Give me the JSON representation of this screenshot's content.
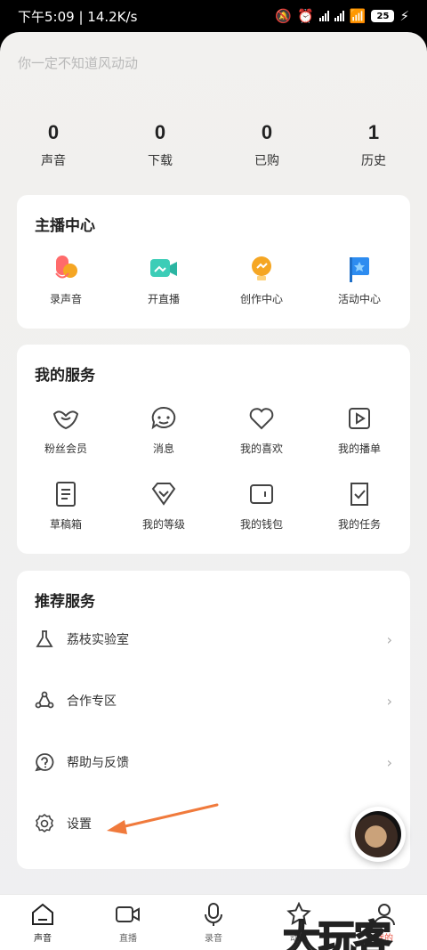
{
  "status_bar": {
    "left_text": "下午5:09 | 14.2K/s",
    "battery": "25"
  },
  "profile": {
    "signature": "你一定不知道风动动"
  },
  "stats": [
    {
      "num": "0",
      "label": "声音"
    },
    {
      "num": "0",
      "label": "下载"
    },
    {
      "num": "0",
      "label": "已购"
    },
    {
      "num": "1",
      "label": "历史"
    }
  ],
  "host_center": {
    "title": "主播中心",
    "items": [
      {
        "label": "录声音",
        "icon": "mic-icon"
      },
      {
        "label": "开直播",
        "icon": "live-camera-icon"
      },
      {
        "label": "创作中心",
        "icon": "lightbulb-icon"
      },
      {
        "label": "活动中心",
        "icon": "flag-icon"
      }
    ]
  },
  "my_services": {
    "title": "我的服务",
    "items": [
      {
        "label": "粉丝会员",
        "icon": "fan-member-icon"
      },
      {
        "label": "消息",
        "icon": "message-icon"
      },
      {
        "label": "我的喜欢",
        "icon": "heart-icon"
      },
      {
        "label": "我的播单",
        "icon": "playlist-icon"
      },
      {
        "label": "草稿箱",
        "icon": "draft-icon"
      },
      {
        "label": "我的等级",
        "icon": "level-icon"
      },
      {
        "label": "我的钱包",
        "icon": "wallet-icon"
      },
      {
        "label": "我的任务",
        "icon": "task-icon"
      }
    ]
  },
  "recommended": {
    "title": "推荐服务",
    "items": [
      {
        "label": "荔枝实验室",
        "icon": "flask-icon",
        "chevron": "›"
      },
      {
        "label": "合作专区",
        "icon": "cooperation-icon",
        "chevron": "›"
      },
      {
        "label": "帮助与反馈",
        "icon": "help-icon",
        "chevron": "›"
      },
      {
        "label": "设置",
        "icon": "settings-icon",
        "chevron": ""
      }
    ]
  },
  "tabs": [
    {
      "label": "声音"
    },
    {
      "label": "直播"
    },
    {
      "label": "录音"
    },
    {
      "label": "动态"
    },
    {
      "label": "我的"
    }
  ],
  "watermark": "大玩客",
  "colors": {
    "accent_arrow": "#f07a3c",
    "orange": "#f5a623",
    "teal": "#3ccdb7",
    "blue": "#2d8cf0",
    "red": "#ff6b6b"
  }
}
